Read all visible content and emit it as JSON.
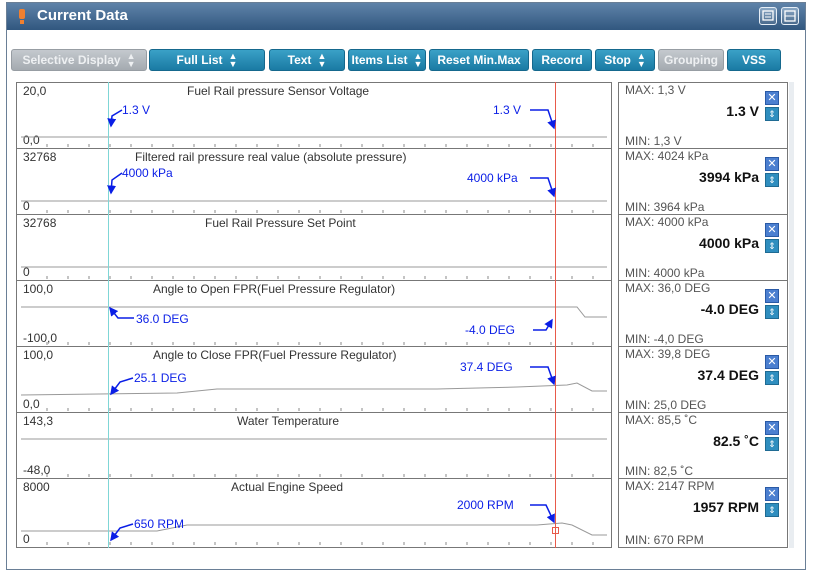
{
  "window": {
    "title": "Current Data",
    "title_icon_color": "#f08030",
    "titlebar_icons": [
      "settings-icon",
      "menu-icon"
    ]
  },
  "toolbar": {
    "buttons": [
      {
        "label": "Selective Display",
        "spinner": true,
        "enabled": false
      },
      {
        "label": "Full List",
        "spinner": true,
        "enabled": true
      },
      {
        "label": "Text",
        "spinner": true,
        "enabled": true
      },
      {
        "label": "Items List",
        "spinner": true,
        "enabled": true
      },
      {
        "label": "Reset Min.Max",
        "spinner": false,
        "enabled": true
      },
      {
        "label": "Record",
        "spinner": false,
        "enabled": true
      },
      {
        "label": "Stop",
        "spinner": true,
        "enabled": true
      },
      {
        "label": "Grouping",
        "spinner": false,
        "enabled": false
      },
      {
        "label": "VSS",
        "spinner": false,
        "enabled": true
      }
    ]
  },
  "colors": {
    "button_blue": "#1a86b0",
    "button_disabled": "#b6bbc0",
    "annotation_blue": "#0a1ee6",
    "cursor_cyan": "#7fd6d6",
    "cursor_red": "#e85a4a"
  },
  "sensors": [
    {
      "name": "Fuel Rail pressure Sensor Voltage",
      "y_max": "20,0",
      "y_min": "0,0",
      "max_text": "MAX:  1,3 V",
      "min_text": "MIN:  1,3 V",
      "current": "1.3 V",
      "ann_left": "1.3 V",
      "ann_right": "1.3 V"
    },
    {
      "name": "Filtered rail pressure real value (absolute pressure)",
      "y_max": "32768",
      "y_min": "0",
      "max_text": "MAX:  4024 kPa",
      "min_text": "MIN:  3964 kPa",
      "current": "3994 kPa",
      "ann_left": "4000 kPa",
      "ann_right": "4000 kPa"
    },
    {
      "name": "Fuel Rail Pressure Set Point",
      "y_max": "32768",
      "y_min": "0",
      "max_text": "MAX:  4000 kPa",
      "min_text": "MIN:  4000 kPa",
      "current": "4000 kPa",
      "ann_left": "",
      "ann_right": ""
    },
    {
      "name": "Angle to Open FPR(Fuel Pressure Regulator)",
      "y_max": "100,0",
      "y_min": "-100,0",
      "max_text": "MAX:  36,0 DEG",
      "min_text": "MIN:  -4,0 DEG",
      "current": "-4.0 DEG",
      "ann_left": "36.0 DEG",
      "ann_right": "-4.0 DEG"
    },
    {
      "name": "Angle to Close FPR(Fuel Pressure Regulator)",
      "y_max": "100,0",
      "y_min": "0,0",
      "max_text": "MAX:  39,8 DEG",
      "min_text": "MIN:  25,0 DEG",
      "current": "37.4 DEG",
      "ann_left": "25.1 DEG",
      "ann_right": "37.4 DEG"
    },
    {
      "name": "Water Temperature",
      "y_max": "143,3",
      "y_min": "-48,0",
      "max_text": "MAX:  85,5 ˚C",
      "min_text": "MIN:  82,5 ˚C",
      "current": "82.5 ˚C",
      "ann_left": "",
      "ann_right": ""
    },
    {
      "name": "Actual Engine Speed",
      "y_max": "8000",
      "y_min": "0",
      "max_text": "MAX:  2147 RPM",
      "min_text": "MIN:  670 RPM",
      "current": "1957 RPM",
      "ann_left": "650 RPM",
      "ann_right": "2000 RPM"
    }
  ]
}
